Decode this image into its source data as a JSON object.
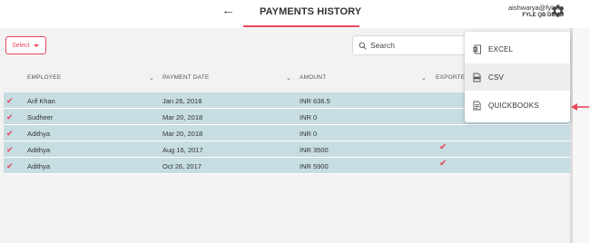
{
  "header": {
    "title": "PAYMENTS HISTORY",
    "user_email": "aishwarya@fyle.in",
    "user_org": "FYLE QB DEMO"
  },
  "toolbar": {
    "select_label": "Select",
    "search_placeholder": "Search"
  },
  "table": {
    "columns": [
      "EMPLOYEE",
      "PAYMENT DATE",
      "AMOUNT",
      "EXPORTED"
    ],
    "rows": [
      {
        "employee": "Arif Khan",
        "date": "Jan 26, 2018",
        "amount": "INR 636.5",
        "exported": false
      },
      {
        "employee": "Sudheer",
        "date": "Mar 20, 2018",
        "amount": "INR 0",
        "exported": false
      },
      {
        "employee": "Adithya",
        "date": "Mar 20, 2018",
        "amount": "INR 0",
        "exported": false
      },
      {
        "employee": "Adithya",
        "date": "Aug 16, 2017",
        "amount": "INR 3500",
        "exported": true
      },
      {
        "employee": "Adithya",
        "date": "Oct 26, 2017",
        "amount": "INR 5900",
        "exported": true
      }
    ]
  },
  "export_menu": {
    "items": [
      {
        "label": "EXCEL",
        "icon": "excel-icon"
      },
      {
        "label": "CSV",
        "icon": "csv-icon"
      },
      {
        "label": "QUICKBOOKS",
        "icon": "quickbooks-icon"
      }
    ]
  },
  "colors": {
    "accent": "#e8465c",
    "row_highlight": "#c6dde2",
    "background": "#f2f2f3"
  }
}
